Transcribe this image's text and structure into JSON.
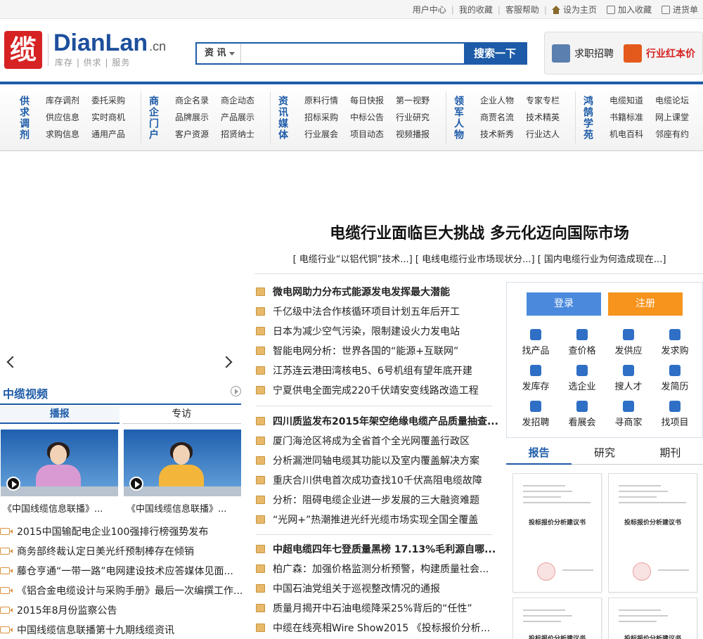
{
  "topbar": {
    "links": [
      "用户中心",
      "我的收藏",
      "客服帮助"
    ],
    "set_home": "设为主页",
    "add_fav": "加入收藏",
    "purchase": "进货单"
  },
  "logo": {
    "mark": "缆",
    "name": "DianLan",
    "tld": ".cn",
    "slogan": "库存 | 供求 | 服务"
  },
  "search": {
    "category": "资 讯",
    "value": "",
    "button": "搜索一下"
  },
  "header_right": {
    "jobs": "求职招聘",
    "price": "行业红本价"
  },
  "nav": {
    "groups": [
      {
        "title": "供求调剂",
        "items": [
          "库存调剂",
          "委托采购",
          "供应信息",
          "实时商机",
          "求购信息",
          "通用产品"
        ]
      },
      {
        "title": "商企门户",
        "items": [
          "商企名录",
          "商企动态",
          "品牌展示",
          "产品展示",
          "客户资源",
          "招贤纳士"
        ]
      },
      {
        "title": "资讯媒体",
        "items": [
          "原料行情",
          "每日快报",
          "第一视野",
          "招标采购",
          "中标公告",
          "行业研究",
          "行业展会",
          "项目动态",
          "视频播报"
        ]
      },
      {
        "title": "领军人物",
        "items": [
          "企业人物",
          "专家专栏",
          "商贾名流",
          "技术精英",
          "技术新秀",
          "行业达人"
        ]
      },
      {
        "title": "鸿鹄学苑",
        "items": [
          "电缆知道",
          "电缆论坛",
          "书籍标准",
          "网上课堂",
          "机电百科",
          "邻座有约"
        ]
      }
    ]
  },
  "video": {
    "title": "中缆视频",
    "tabs": [
      "播报",
      "专访"
    ],
    "thumbs": [
      {
        "caption": "《中国线缆信息联播》..."
      },
      {
        "caption": "《中国线缆信息联播》..."
      }
    ],
    "list": [
      "2015中国输配电企业100强排行榜强势发布",
      "商务部终裁认定日美光纤预制棒存在倾销",
      "藤仓亨通“一带一路”电网建设技术应答媒体见面...",
      "《铝合金电缆设计与采购手册》最后一次编撰工作...",
      "2015年8月份监察公告",
      "中国线缆信息联播第十九期线缆资讯"
    ]
  },
  "headline": {
    "title": "电缆行业面临巨大挑战 多元化迈向国际市场",
    "sublinks": [
      "[ 电缆行业“以铝代铜”技术...]",
      "[ 电线电缆行业市场现状分...]",
      "[ 国内电缆行业为何造成现在...]"
    ]
  },
  "news": {
    "block1": [
      "微电网助力分布式能源发电发挥最大潜能",
      "千亿级中法合作核循环项目计划五年后开工",
      "日本为减少空气污染，限制建设火力发电站",
      "智能电网分析：世界各国的“能源+互联网”",
      "江苏连云港田湾核电5、6号机组有望年底开建",
      "宁夏供电全面完成220千伏靖安变线路改造工程"
    ],
    "block2": [
      "四川质监发布2015年架空绝缘电缆产品质量抽查...",
      "厦门海沧区将成为全省首个全光网覆盖行政区",
      "分析漏泄同轴电缆其功能以及室内覆盖解决方案",
      "重庆合川供电首次成功查找10千伏高阻电缆故障",
      "分析：阻碍电缆企业进一步发展的三大融资难题",
      "“光网+”热潮推进光纤光缆市场实现全国全覆盖"
    ],
    "block3": [
      "中超电缆四年七登质量黑榜 17.13%毛利源自哪...",
      "柏广森：加强价格监测分析预警，构建质量社会...",
      "中国石油党组关于巡视整改情况的通报",
      "质量月揭开中石油电缆降采25%背后的“任性”",
      "中缆在线亮相Wire Show2015 《投标报价分析..."
    ]
  },
  "user_panel": {
    "login": "登录",
    "register": "注册",
    "quick": [
      {
        "label": "找产品",
        "icon": "cube-icon"
      },
      {
        "label": "查价格",
        "icon": "search-icon"
      },
      {
        "label": "发供应",
        "icon": "truck-icon"
      },
      {
        "label": "发求购",
        "icon": "cart-icon"
      },
      {
        "label": "发库存",
        "icon": "warehouse-icon"
      },
      {
        "label": "选企业",
        "icon": "building-icon"
      },
      {
        "label": "搜人才",
        "icon": "person-search-icon"
      },
      {
        "label": "发简历",
        "icon": "resume-icon"
      },
      {
        "label": "发招聘",
        "icon": "group-icon"
      },
      {
        "label": "看展会",
        "icon": "eye-icon"
      },
      {
        "label": "寻商家",
        "icon": "person-icon"
      },
      {
        "label": "找项目",
        "icon": "project-icon"
      }
    ]
  },
  "report_tabs": [
    "报告",
    "研究",
    "期刊"
  ],
  "reports": [
    {
      "title": "投标报价分析建议书"
    },
    {
      "title": "投标报价分析建议书"
    },
    {
      "title": "投标报价分析建议书"
    },
    {
      "title": "投标报价分析建议书"
    }
  ],
  "colors": {
    "brand_blue": "#1d5ba8",
    "login": "#4a89dc",
    "register": "#f7941d",
    "logo_red": "#d62222"
  }
}
